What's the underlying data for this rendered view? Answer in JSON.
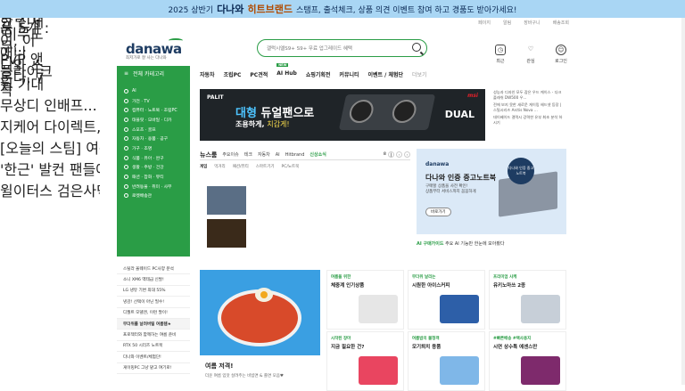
{
  "banner": {
    "year": "2025 상반기",
    "brand": "다나와",
    "title": "히트브랜드",
    "desc": "스탬프, 출석체크, 상품 의견 이벤트 참여 하고 경품도 받아가세요!"
  },
  "utility": [
    "페이지",
    "알림",
    "장바구니",
    "배송조회"
  ],
  "logo": {
    "name": "danawa",
    "tagline": "최저가로 잘 사는 다나와"
  },
  "search": {
    "placeholder": "갤럭시엘S9+ S9+ 무료 업그레이드 혜택"
  },
  "top_icons": [
    {
      "label": "최근",
      "icon": "clock-icon",
      "glyph": "◷"
    },
    {
      "label": "관심",
      "icon": "heart-icon",
      "glyph": "♡"
    },
    {
      "label": "로그인",
      "icon": "user-icon",
      "glyph": "☺"
    }
  ],
  "category_button": "전체 카테고리",
  "nav": {
    "items": [
      "자동차",
      "조립PC",
      "PC견적",
      "AI Hub",
      "쇼핑기획전",
      "커뮤니티",
      "이벤트 / 체험단"
    ],
    "more": "더보기",
    "new_badge": "NEW"
  },
  "sidebar": [
    "AI",
    "가전 · TV",
    "컴퓨터 · 노트북 · 조립PC",
    "태블릿 · 모바일 · 디카",
    "스포츠 · 골프",
    "자동차 · 용품 · 공구",
    "가구 · 조명",
    "식품 · 유아 · 완구",
    "생활 · 주방 · 건강",
    "패션 · 잡화 · 뷰티",
    "반려동물 · 취미 · 사무",
    "로켓배송관"
  ],
  "hero": {
    "brand": "PALIT",
    "line1": "대형",
    "line1b": " 듀얼팬으로",
    "line2": "조용하게, ",
    "line2b": "치갑게!",
    "model": "DUAL",
    "corner": "msi"
  },
  "notices": [
    "성능과 디자인 모두 잡은 우드 케이스 - 다크플래쉬 DW500 우...",
    "전에 보지 못한 새로운 게이밍 헤드셋 등장 | 스틸시리즈 Arctis Nova ...",
    "데이베이드 갤럭시 강력한 유부 최초 분석 하시기"
  ],
  "news": {
    "title": "뉴스룸",
    "tabs": [
      "주요이슈",
      "테크",
      "자동차",
      "AI",
      "Hitbrand"
    ],
    "hot": "신상소식",
    "page": "8",
    "sub_tabs": [
      "게임",
      "먹거리",
      "패션/뷰티",
      "스마트기기",
      "PC/노트북"
    ],
    "left": [
      "2025, 7월의 주목할 만한 신제품 5개 : '이무도이, 이무...",
      "애니 PvP 앤디와 스플라이크 온다, 7월 기대작"
    ],
    "right": [
      "무상디 인배프... 7월 신작 게임 총정리",
      "지케어 다이렉트, 돌 글리는 '시식포스 시뮬레이'가...",
      "[오늘의 스팀] 여름 세일, 90% 이상 할인 블랙잭 '포...",
      "'한근' 발컨 팬들에 '베이비신레택' 패러 7 월 점식...",
      "윌이터스 검은사막 콘솔, PS5, XBOX 시리즈 X/S ..."
    ]
  },
  "promo": {
    "logo": "danawa",
    "title": "다나와 인증 중고노트북",
    "desc1": "구매할 상품을 사전 확인!",
    "desc2": "상품부터 서비스까지 꼼꼼하게",
    "button": "바로가기",
    "seal": "다나와 인증 중고노트북"
  },
  "ai_guide": {
    "label": "AI 구매가이드",
    "text": "주요 AI 기능만 한눈에 모아봤다"
  },
  "leftlist": [
    "스틸라 올웨이드 PC사양 분석",
    "소니 XM6 엑테급 신발!",
    "LG 냉뮤 기변 최대 55%",
    "냉감! 선택이 아닌 필수!",
    "디월트 모델엔, 이런 팔이!",
    "무더위를 날려버릴 여름템★",
    "프로젝터와 함께하는 여름 준비",
    "RTX 50 시리즈 노트북",
    "다나와 이벤트/체험단!",
    "게이밍PC 그냥 맡고 여기로!"
  ],
  "leftlist_selected": 5,
  "feature": {
    "title": "여름 저격!",
    "desc": "더운 여름 입맛 살려주는 비빔면 & 쫄면 모음♥"
  },
  "grid": [
    {
      "l1": "여름을 위한",
      "l2": "체중계 인기상품",
      "color": "#e6e6e6"
    },
    {
      "l1": "무더위 날리는",
      "l2": "시원한 아이스커피",
      "color": "#2d5fa8"
    },
    {
      "l1": "프리미엄 사케",
      "l2": "유키노마쓰 2종",
      "color": "#c7cfd8"
    },
    {
      "l1": "시작된 장마",
      "l2": "지금 필요한 건?",
      "color": "#e94560"
    },
    {
      "l1": "여름밤의 불청객",
      "l2": "모기퇴치 용품",
      "color": "#7fb7e8"
    },
    {
      "l1": "#빠른배송 #택사용지",
      "l2": "시연 상수특 에센스만",
      "color": "#7e2a6c"
    }
  ]
}
